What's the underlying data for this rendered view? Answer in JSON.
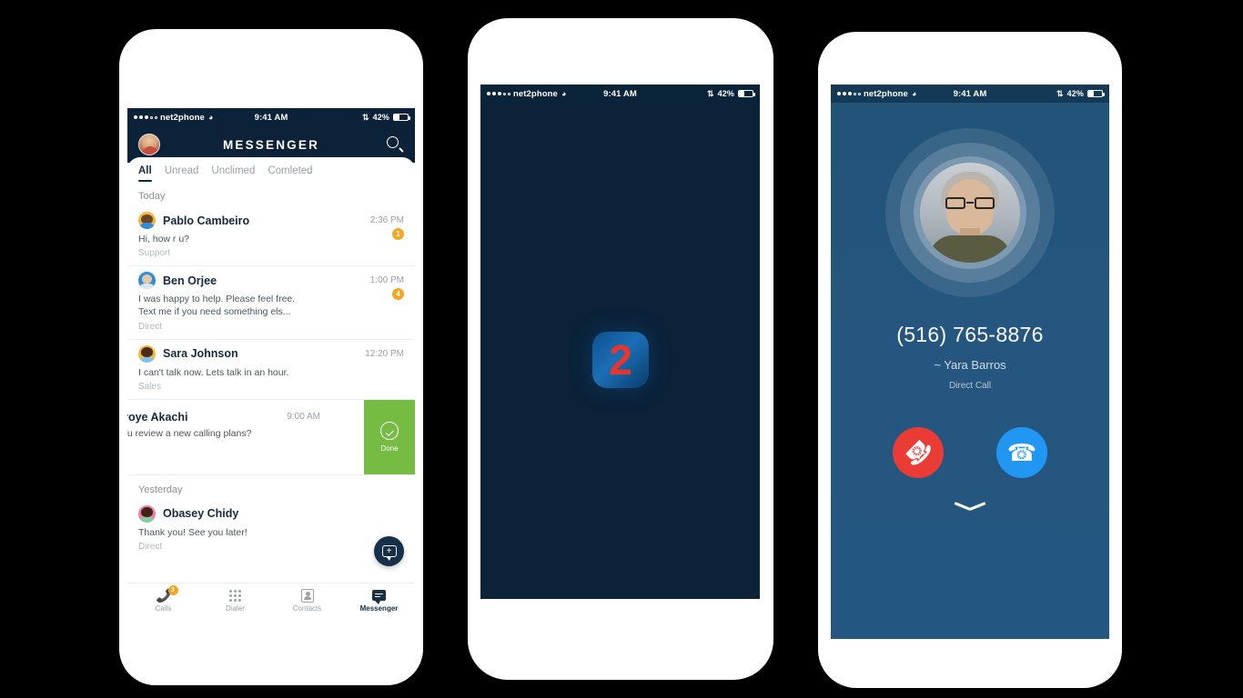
{
  "status_bar": {
    "carrier": "net2phone",
    "time": "9:41 AM",
    "battery_percent": "42%",
    "signal_dots_filled": 3,
    "signal_dots_empty": 2,
    "wifi_icon": "wifi-icon",
    "bluetooth_icon": "bluetooth-icon"
  },
  "phone1": {
    "header": {
      "title": "MESSENGER",
      "avatar_name": "user-avatar",
      "search_icon": "search-icon"
    },
    "tabs": [
      {
        "label": "All",
        "active": true
      },
      {
        "label": "Unread",
        "active": false
      },
      {
        "label": "Unclimed",
        "active": false
      },
      {
        "label": "Comleted",
        "active": false
      }
    ],
    "sections": [
      {
        "day": "Today",
        "conversations": [
          {
            "name": "Pablo Cambeiro",
            "time": "2:36 PM",
            "preview": "Hi, how r u?",
            "tag": "Support",
            "unread": "1",
            "swiped": false
          },
          {
            "name": "Ben Orjee",
            "time": "1:00 PM",
            "preview": "I was happy to help. Please feel free.\nText me if you need something els...",
            "tag": "Direct",
            "unread": "4",
            "swiped": false
          },
          {
            "name": "Sara Johnson",
            "time": "12:20 PM",
            "preview": "I can't talk now. Lets talk in an hour.",
            "tag": "Sales",
            "unread": "",
            "swiped": false
          },
          {
            "name": "voye Akachi",
            "time": "9:00 AM",
            "preview": "ou review a new calling plans?",
            "tag": "",
            "unread": "",
            "swiped": true,
            "action_label": "Done",
            "action_icon": "check-circle-icon"
          }
        ]
      },
      {
        "day": "Yesterday",
        "conversations": [
          {
            "name": "Obasey Chidy",
            "time": "",
            "preview": "Thank you! See you later!",
            "tag": "Direct",
            "unread": "",
            "swiped": false
          }
        ]
      }
    ],
    "fab": {
      "icon": "new-message-icon"
    },
    "tabbar": [
      {
        "label": "Calls",
        "icon": "phone-icon",
        "badge": "3",
        "active": false
      },
      {
        "label": "Dialer",
        "icon": "dialpad-icon",
        "badge": "",
        "active": false
      },
      {
        "label": "Contacts",
        "icon": "contacts-icon",
        "badge": "",
        "active": false
      },
      {
        "label": "Messenger",
        "icon": "messenger-icon",
        "badge": "",
        "active": true
      }
    ]
  },
  "phone2": {
    "splash": {
      "logo_digit": "2",
      "logo_name": "net2phone-logo",
      "background_color": "#0b2239",
      "logo_square_color": "#1b6fb5",
      "logo_digit_color": "#e8352e"
    }
  },
  "phone3": {
    "call": {
      "number": "(516) 765-8876",
      "caller_name": "~ Yara Barros",
      "call_type": "Direct Call",
      "avatar_name": "caller-avatar",
      "decline_label": "decline-call",
      "accept_label": "accept-call",
      "decline_color": "#ea3b35",
      "accept_color": "#2196f3",
      "minimize_icon": "chevron-down-icon",
      "background_color": "#235680"
    }
  }
}
